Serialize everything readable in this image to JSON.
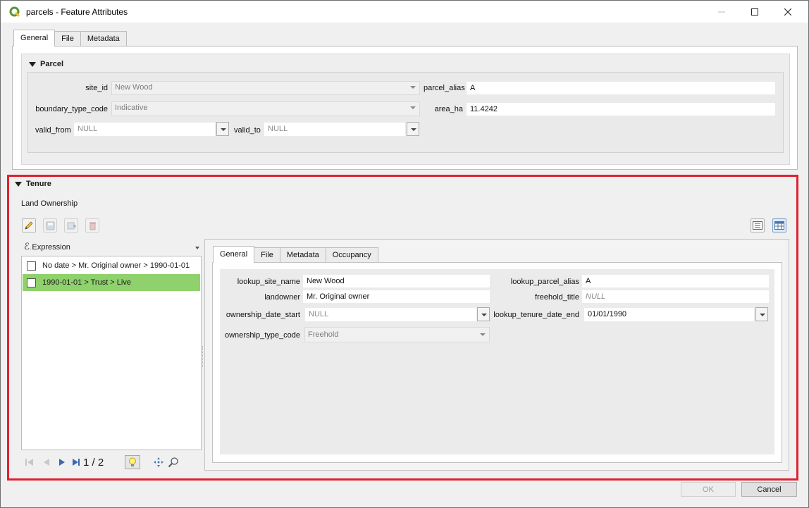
{
  "window": {
    "title": "parcels - Feature Attributes"
  },
  "main_tabs": [
    "General",
    "File",
    "Metadata"
  ],
  "parcel": {
    "heading": "Parcel",
    "site_id": {
      "label": "site_id",
      "value": "New Wood"
    },
    "parcel_alias": {
      "label": "parcel_alias",
      "value": "A"
    },
    "boundary_type_code": {
      "label": "boundary_type_code",
      "value": "Indicative"
    },
    "area_ha": {
      "label": "area_ha",
      "value": "11.4242"
    },
    "valid_from": {
      "label": "valid_from",
      "value": "NULL"
    },
    "valid_to": {
      "label": "valid_to",
      "value": "NULL"
    }
  },
  "tenure": {
    "heading": "Tenure",
    "relation_label": "Land Ownership",
    "expression_label": "Expression",
    "list_items": [
      "No date > Mr. Original owner > 1990-01-01",
      "1990-01-01 > Trust > Live"
    ],
    "nav_counter": "1 / 2",
    "sub_tabs": [
      "General",
      "File",
      "Metadata",
      "Occupancy"
    ],
    "form": {
      "lookup_site_name": {
        "label": "lookup_site_name",
        "value": "New Wood"
      },
      "lookup_parcel_alias": {
        "label": "lookup_parcel_alias",
        "value": "A"
      },
      "landowner": {
        "label": "landowner",
        "value": "Mr. Original owner"
      },
      "freehold_title": {
        "label": "freehold_title",
        "value": "NULL"
      },
      "ownership_date_start": {
        "label": "ownership_date_start",
        "value": "NULL"
      },
      "lookup_tenure_date_end": {
        "label": "lookup_tenure_date_end",
        "value": "01/01/1990"
      },
      "ownership_type_code": {
        "label": "ownership_type_code",
        "value": "Freehold"
      }
    }
  },
  "buttons": {
    "ok": "OK",
    "cancel": "Cancel"
  },
  "colors": {
    "selected_row": "#8fd16c",
    "highlight_border": "#e02030",
    "qgis_green": "#589632"
  }
}
